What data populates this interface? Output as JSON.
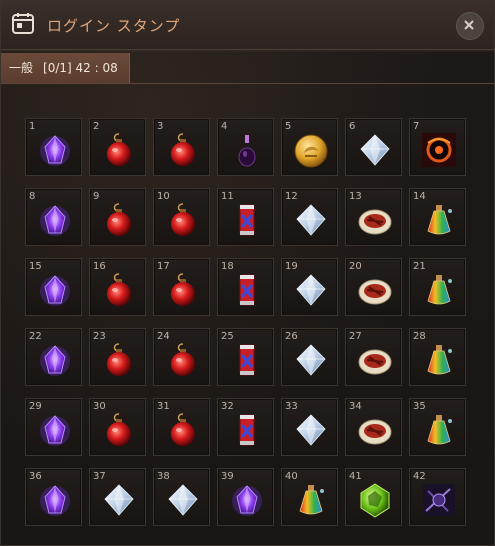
{
  "window": {
    "title": "ログイン スタンプ",
    "icon": "calendar-icon",
    "close_icon": "close-icon"
  },
  "tab": {
    "category": "一般",
    "progress": "[0/1]",
    "timer": "42 : 08"
  },
  "days": [
    {
      "day": "1",
      "item": "purple-crystal-icon"
    },
    {
      "day": "2",
      "item": "red-potion-icon"
    },
    {
      "day": "3",
      "item": "red-potion-icon"
    },
    {
      "day": "4",
      "item": "dark-vial-icon"
    },
    {
      "day": "5",
      "item": "gold-coin-icon"
    },
    {
      "day": "6",
      "item": "white-diamond-icon"
    },
    {
      "day": "7",
      "item": "fire-orb-icon"
    },
    {
      "day": "8",
      "item": "purple-crystal-icon"
    },
    {
      "day": "9",
      "item": "red-potion-icon"
    },
    {
      "day": "10",
      "item": "red-potion-icon"
    },
    {
      "day": "11",
      "item": "red-can-icon"
    },
    {
      "day": "12",
      "item": "white-diamond-icon"
    },
    {
      "day": "13",
      "item": "meat-plate-icon"
    },
    {
      "day": "14",
      "item": "rainbow-potion-icon"
    },
    {
      "day": "15",
      "item": "purple-crystal-icon"
    },
    {
      "day": "16",
      "item": "red-potion-icon"
    },
    {
      "day": "17",
      "item": "red-potion-icon"
    },
    {
      "day": "18",
      "item": "red-can-icon"
    },
    {
      "day": "19",
      "item": "white-diamond-icon"
    },
    {
      "day": "20",
      "item": "meat-plate-icon"
    },
    {
      "day": "21",
      "item": "rainbow-potion-icon"
    },
    {
      "day": "22",
      "item": "purple-crystal-icon"
    },
    {
      "day": "23",
      "item": "red-potion-icon"
    },
    {
      "day": "24",
      "item": "red-potion-icon"
    },
    {
      "day": "25",
      "item": "red-can-icon"
    },
    {
      "day": "26",
      "item": "white-diamond-icon"
    },
    {
      "day": "27",
      "item": "meat-plate-icon"
    },
    {
      "day": "28",
      "item": "rainbow-potion-icon"
    },
    {
      "day": "29",
      "item": "purple-crystal-icon"
    },
    {
      "day": "30",
      "item": "red-potion-icon"
    },
    {
      "day": "31",
      "item": "red-potion-icon"
    },
    {
      "day": "32",
      "item": "red-can-icon"
    },
    {
      "day": "33",
      "item": "white-diamond-icon"
    },
    {
      "day": "34",
      "item": "meat-plate-icon"
    },
    {
      "day": "35",
      "item": "rainbow-potion-icon"
    },
    {
      "day": "36",
      "item": "purple-crystal-icon"
    },
    {
      "day": "37",
      "item": "white-diamond-icon"
    },
    {
      "day": "38",
      "item": "white-diamond-icon"
    },
    {
      "day": "39",
      "item": "purple-crystal-icon"
    },
    {
      "day": "40",
      "item": "rainbow-potion-icon"
    },
    {
      "day": "41",
      "item": "green-gem-icon"
    },
    {
      "day": "42",
      "item": "dark-scroll-icon"
    }
  ],
  "colors": {
    "title": "#e0a77a",
    "tab_bg": "#6b4a39",
    "cell_border": "#3d342e"
  }
}
